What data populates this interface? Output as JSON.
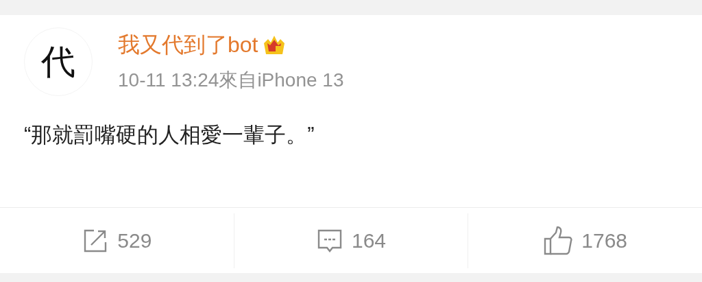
{
  "post": {
    "avatar_text": "代",
    "author": "我又代到了bot",
    "meta": "10-11 13:24來自iPhone 13",
    "content": "“那就罰嘴硬的人相愛一輩子。”",
    "actions": [
      {
        "kind": "repost",
        "count": "529"
      },
      {
        "kind": "comment",
        "count": "164"
      },
      {
        "kind": "like",
        "count": "1768"
      }
    ]
  }
}
